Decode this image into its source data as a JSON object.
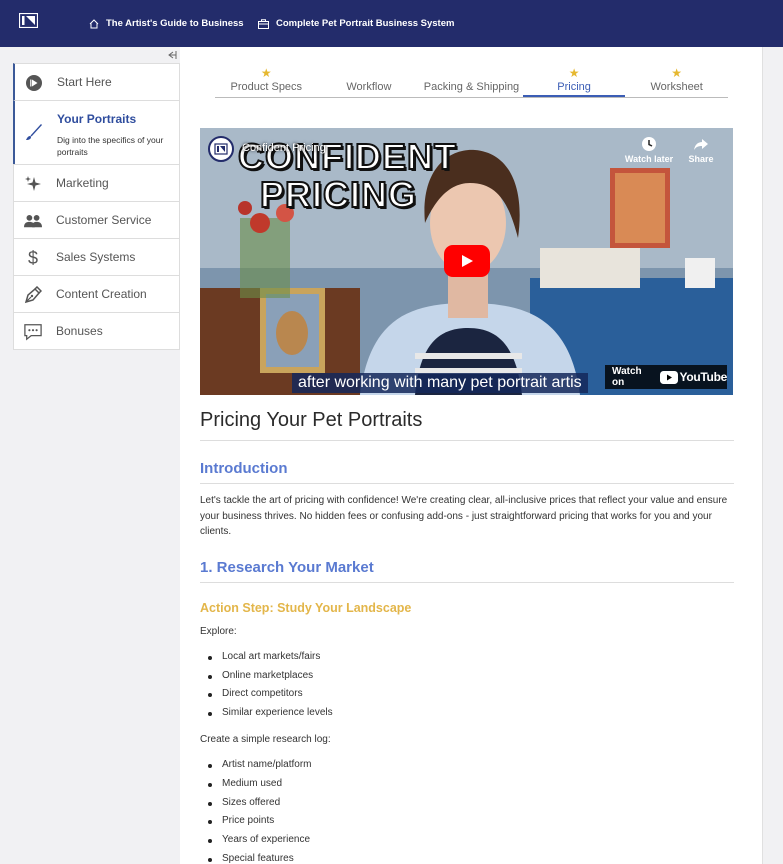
{
  "topbar": {
    "crumbs": [
      "The Artist's Guide to Business",
      "Complete Pet Portrait Business System"
    ]
  },
  "sidebar": {
    "items": [
      {
        "label": "Start Here",
        "icon": "play-circle-icon"
      },
      {
        "label": "Your Portraits",
        "desc": "Dig into the specifics of your portraits",
        "icon": "brush-icon"
      },
      {
        "label": "Marketing",
        "icon": "sparkle-icon"
      },
      {
        "label": "Customer Service",
        "icon": "people-icon"
      },
      {
        "label": "Sales Systems",
        "icon": "dollar-icon"
      },
      {
        "label": "Content Creation",
        "icon": "pen-nib-icon"
      },
      {
        "label": "Bonuses",
        "icon": "chat-dots-icon"
      }
    ]
  },
  "tabs": [
    {
      "label": "Product Specs",
      "star": true
    },
    {
      "label": "Workflow",
      "star": false
    },
    {
      "label": "Packing & Shipping",
      "star": false
    },
    {
      "label": "Pricing",
      "star": true,
      "active": true
    },
    {
      "label": "Worksheet",
      "star": true
    }
  ],
  "video": {
    "title_big_1": "CONFIDENT",
    "title_big_2": "PRICING",
    "title_small": "Confident Pricing",
    "watch_later": "Watch later",
    "share": "Share",
    "caption": "after working with many pet portrait artis",
    "watch_on": "Watch on",
    "youtube": "YouTube"
  },
  "article": {
    "title": "Pricing Your Pet Portraits",
    "intro_heading": "Introduction",
    "intro_text": "Let's tackle the art of pricing with confidence! We're creating clear, all-inclusive prices that reflect your value and ensure your business thrives. No hidden fees or confusing add-ons - just straightforward pricing that works for you and your clients.",
    "section1_heading": "1. Research Your Market",
    "action_heading": "Action Step: Study Your Landscape",
    "explore_label": "Explore:",
    "explore_items": [
      "Local art markets/fairs",
      "Online marketplaces",
      "Direct competitors",
      "Similar experience levels"
    ],
    "log_label": "Create a simple research log:",
    "log_items": [
      "Artist name/platform",
      "Medium used",
      "Sizes offered",
      "Price points",
      "Years of experience",
      "Special features"
    ]
  },
  "colors": {
    "topbar": "#232c6b",
    "accent": "#3b5db5",
    "heading_blue": "#5a7ad1",
    "action_gold": "#e3b64a",
    "star": "#e6b830"
  }
}
